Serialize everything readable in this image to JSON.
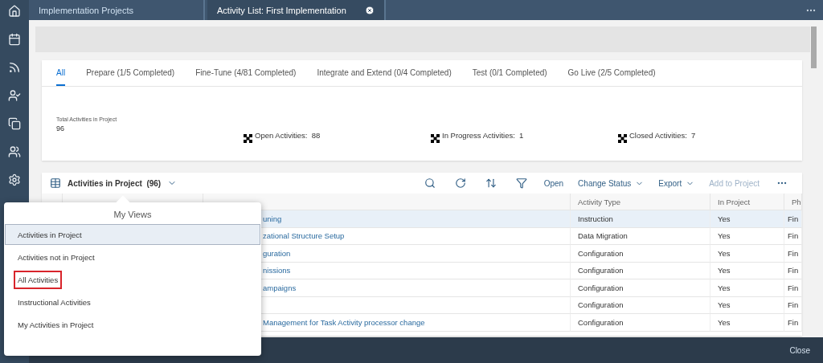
{
  "top_tabs": [
    {
      "label": "Implementation Projects",
      "selected": false,
      "closable": false
    },
    {
      "label": "Activity List: First Implementation",
      "selected": true,
      "closable": true
    }
  ],
  "phase_tabs": [
    {
      "label": "All",
      "selected": true
    },
    {
      "label": "Prepare (1/5 Completed)",
      "selected": false
    },
    {
      "label": "Fine-Tune (4/81 Completed)",
      "selected": false
    },
    {
      "label": "Integrate and Extend (0/4 Completed)",
      "selected": false
    },
    {
      "label": "Test (0/1 Completed)",
      "selected": false
    },
    {
      "label": "Go Live (2/5 Completed)",
      "selected": false
    }
  ],
  "total": {
    "label": "Total Activities in Project",
    "value": "96"
  },
  "stats": [
    {
      "label": "Open Activities:",
      "value": "88"
    },
    {
      "label": "In Progress Activities:",
      "value": "1"
    },
    {
      "label": "Closed Activities:",
      "value": "7"
    }
  ],
  "table_toolbar": {
    "title": "Activities in Project",
    "count": "(96)",
    "actions": [
      {
        "label": "Open",
        "kind": "plain",
        "disabled": false
      },
      {
        "label": "Change Status",
        "kind": "menu",
        "disabled": false
      },
      {
        "label": "Export",
        "kind": "menu",
        "disabled": false
      },
      {
        "label": "Add to Project",
        "kind": "plain",
        "disabled": true
      }
    ]
  },
  "table": {
    "columns": [
      "Activity Type",
      "In Project",
      "Ph"
    ],
    "rows": [
      {
        "name": "uning",
        "type": "Instruction",
        "in_project": "Yes",
        "phase": "Fin",
        "selected": true
      },
      {
        "name": "zational Structure Setup",
        "type": "Data Migration",
        "in_project": "Yes",
        "phase": "Fin",
        "selected": false
      },
      {
        "name": "guration",
        "type": "Configuration",
        "in_project": "Yes",
        "phase": "Fin",
        "selected": false
      },
      {
        "name": "nissions",
        "type": "Configuration",
        "in_project": "Yes",
        "phase": "Fin",
        "selected": false
      },
      {
        "name": "ampaigns",
        "type": "Configuration",
        "in_project": "Yes",
        "phase": "Fin",
        "selected": false
      },
      {
        "type": "Configuration",
        "in_project": "Yes",
        "phase": "Fin",
        "selected": false
      },
      {
        "name": "Management for Task Activity processor change",
        "type": "Configuration",
        "in_project": "Yes",
        "phase": "Fin",
        "selected": false
      }
    ]
  },
  "views_popover": {
    "title": "My Views",
    "items": [
      {
        "label": "Activities in Project",
        "selected": true,
        "marked": false
      },
      {
        "label": "Activities not in Project",
        "selected": false,
        "marked": false
      },
      {
        "label": "All Activities",
        "selected": false,
        "marked": true
      },
      {
        "label": "Instructional Activities",
        "selected": false,
        "marked": false
      },
      {
        "label": "My Activities in Project",
        "selected": false,
        "marked": false
      }
    ]
  },
  "footer": {
    "close": "Close"
  }
}
